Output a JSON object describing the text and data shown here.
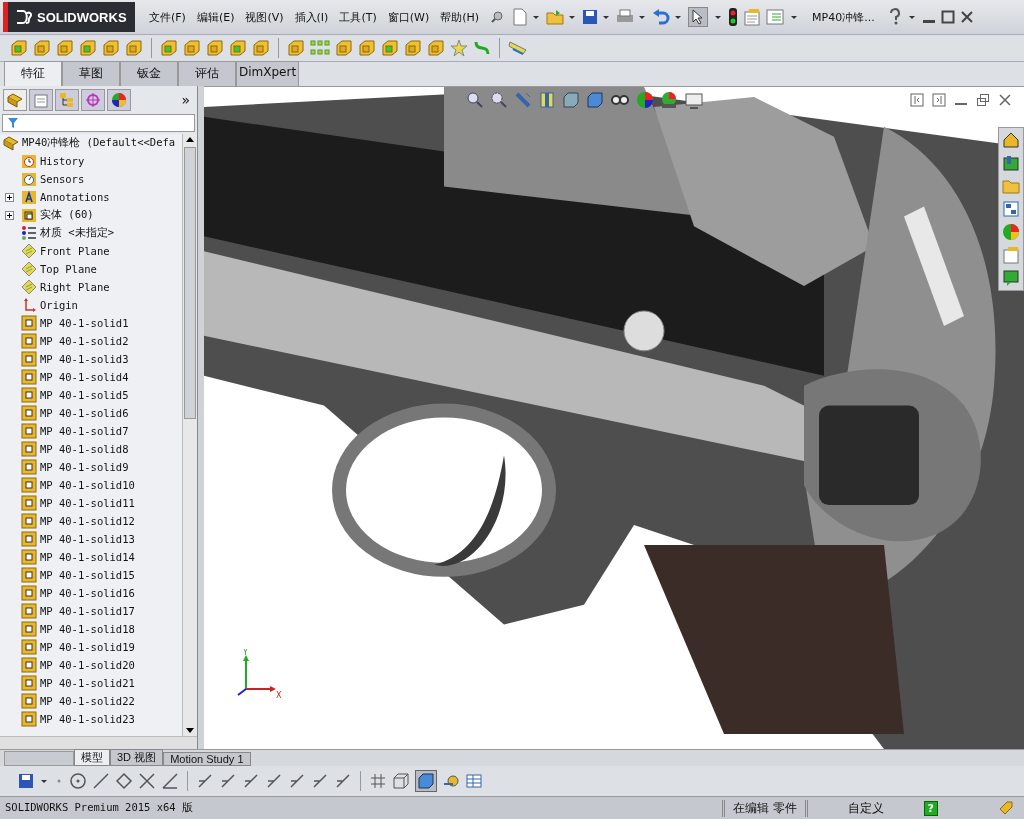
{
  "app": {
    "logo": "SOLIDWORKS",
    "document_title": "MP40冲锋..."
  },
  "menu": [
    "文件(F)",
    "编辑(E)",
    "视图(V)",
    "插入(I)",
    "工具(T)",
    "窗口(W)",
    "帮助(H)"
  ],
  "command_tabs": [
    {
      "label": "特征",
      "selected": true
    },
    {
      "label": "草图",
      "selected": false
    },
    {
      "label": "钣金",
      "selected": false
    },
    {
      "label": "评估",
      "selected": false
    },
    {
      "label": "DimXpert",
      "selected": false
    }
  ],
  "feature_tree": {
    "root": "MP40冲锋枪  (Default<<Defa",
    "items": [
      {
        "kind": "history",
        "label": "History"
      },
      {
        "kind": "sensor",
        "label": "Sensors"
      },
      {
        "kind": "annotation",
        "label": "Annotations",
        "expanded": false
      },
      {
        "kind": "bodies",
        "label": "实体 (60)",
        "expanded": false
      },
      {
        "kind": "material",
        "label": "材质 <未指定>"
      },
      {
        "kind": "plane",
        "label": "Front Plane"
      },
      {
        "kind": "plane",
        "label": "Top Plane"
      },
      {
        "kind": "plane",
        "label": "Right Plane"
      },
      {
        "kind": "origin",
        "label": "Origin"
      },
      {
        "kind": "part",
        "label": "MP 40-1-solid1"
      },
      {
        "kind": "part",
        "label": "MP 40-1-solid2"
      },
      {
        "kind": "part",
        "label": "MP 40-1-solid3"
      },
      {
        "kind": "part",
        "label": "MP 40-1-solid4"
      },
      {
        "kind": "part",
        "label": "MP 40-1-solid5"
      },
      {
        "kind": "part",
        "label": "MP 40-1-solid6"
      },
      {
        "kind": "part",
        "label": "MP 40-1-solid7"
      },
      {
        "kind": "part",
        "label": "MP 40-1-solid8"
      },
      {
        "kind": "part",
        "label": "MP 40-1-solid9"
      },
      {
        "kind": "part",
        "label": "MP 40-1-solid10"
      },
      {
        "kind": "part",
        "label": "MP 40-1-solid11"
      },
      {
        "kind": "part",
        "label": "MP 40-1-solid12"
      },
      {
        "kind": "part",
        "label": "MP 40-1-solid13"
      },
      {
        "kind": "part",
        "label": "MP 40-1-solid14"
      },
      {
        "kind": "part",
        "label": "MP 40-1-solid15"
      },
      {
        "kind": "part",
        "label": "MP 40-1-solid16"
      },
      {
        "kind": "part",
        "label": "MP 40-1-solid17"
      },
      {
        "kind": "part",
        "label": "MP 40-1-solid18"
      },
      {
        "kind": "part",
        "label": "MP 40-1-solid19"
      },
      {
        "kind": "part",
        "label": "MP 40-1-solid20"
      },
      {
        "kind": "part",
        "label": "MP 40-1-solid21"
      },
      {
        "kind": "part",
        "label": "MP 40-1-solid22"
      },
      {
        "kind": "part",
        "label": "MP 40-1-solid23"
      }
    ]
  },
  "panel_more": "»",
  "triad": {
    "y": "Y",
    "x": "X"
  },
  "bottom_tabs": [
    {
      "label": "模型",
      "selected": true
    },
    {
      "label": "3D 视图",
      "selected": false
    },
    {
      "label": "Motion Study 1",
      "selected": false
    }
  ],
  "status_bar": {
    "product": "SOLIDWORKS Premium 2015 x64 版",
    "mode": "在编辑 零件",
    "units": "自定义",
    "help": "?"
  }
}
